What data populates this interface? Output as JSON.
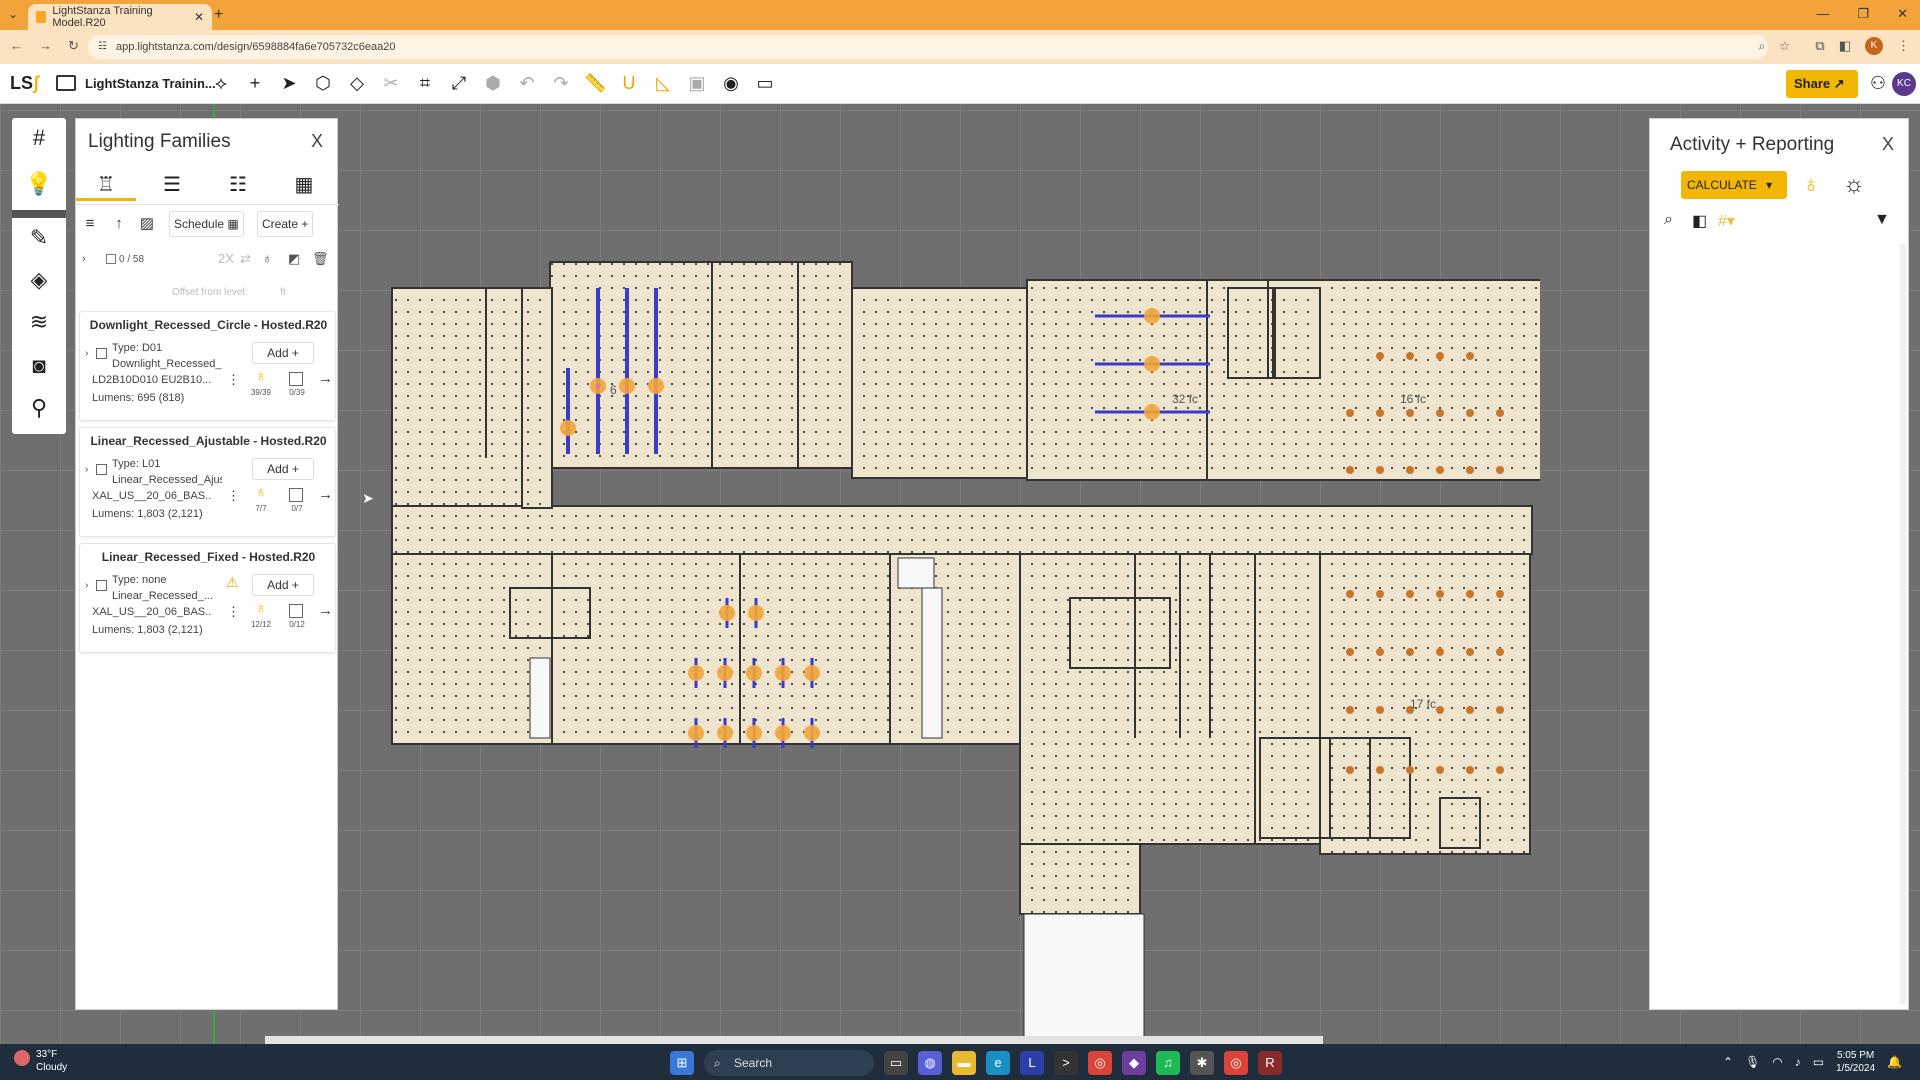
{
  "browser": {
    "tab_title": "LightStanza Training Model.R20",
    "url": "app.lightstanza.com/design/6598884fa6e705732c6eaa20"
  },
  "app": {
    "logo": "LS",
    "project_name": "LightStanza Trainin...",
    "share_label": "Share",
    "user_initials": "KC"
  },
  "lighting_families": {
    "title": "Lighting Families",
    "close": "X",
    "schedule_label": "Schedule",
    "create_label": "Create",
    "selection_count": "0 / 58",
    "multiplier": "2X",
    "offset_label": "Offset from level:",
    "offset_unit": "ft",
    "families": [
      {
        "name": "Downlight_Recessed_Circle - Hosted.R20",
        "type_line": "Type: D01",
        "type_sub": "Downlight_Recessed_C...",
        "add_label": "Add",
        "catalog": "LD2B10D010 EU2B10...",
        "bulb_count": "39/39",
        "sq_count": "0/39",
        "lumens": "Lumens: 695 (818)",
        "warning": false
      },
      {
        "name": "Linear_Recessed_Ajustable - Hosted.R20",
        "type_line": "Type: L01",
        "type_sub": "Linear_Recessed_Ajust...",
        "add_label": "Add",
        "catalog": "XAL_US__20_06_BAS...",
        "bulb_count": "7/7",
        "sq_count": "0/7",
        "lumens": "Lumens: 1,803 (2,121)",
        "warning": false
      },
      {
        "name": "Linear_Recessed_Fixed - Hosted.R20",
        "type_line": "Type: none",
        "type_sub": "Linear_Recessed_...",
        "add_label": "Add",
        "catalog": "XAL_US__20_06_BAS...",
        "bulb_count": "12/12",
        "sq_count": "0/12",
        "lumens": "Lumens: 1,803 (2,121)",
        "warning": true
      }
    ]
  },
  "activity": {
    "title": "Activity + Reporting",
    "close": "X",
    "calculate_label": "CALCULATE"
  },
  "plan_labels": {
    "fc_1": "32 fc",
    "fc_2": "16 fc",
    "fc_3": "17 fc",
    "fc_4": "6"
  },
  "taskbar": {
    "temp": "33°F",
    "condition": "Cloudy",
    "search": "Search",
    "time": "5:05 PM",
    "date": "1/5/2024"
  },
  "colors": {
    "accent": "#f2b705",
    "tab_bar": "#f2a33a",
    "floor": "#efe5cf",
    "linear_fixture": "#3a3acb"
  }
}
